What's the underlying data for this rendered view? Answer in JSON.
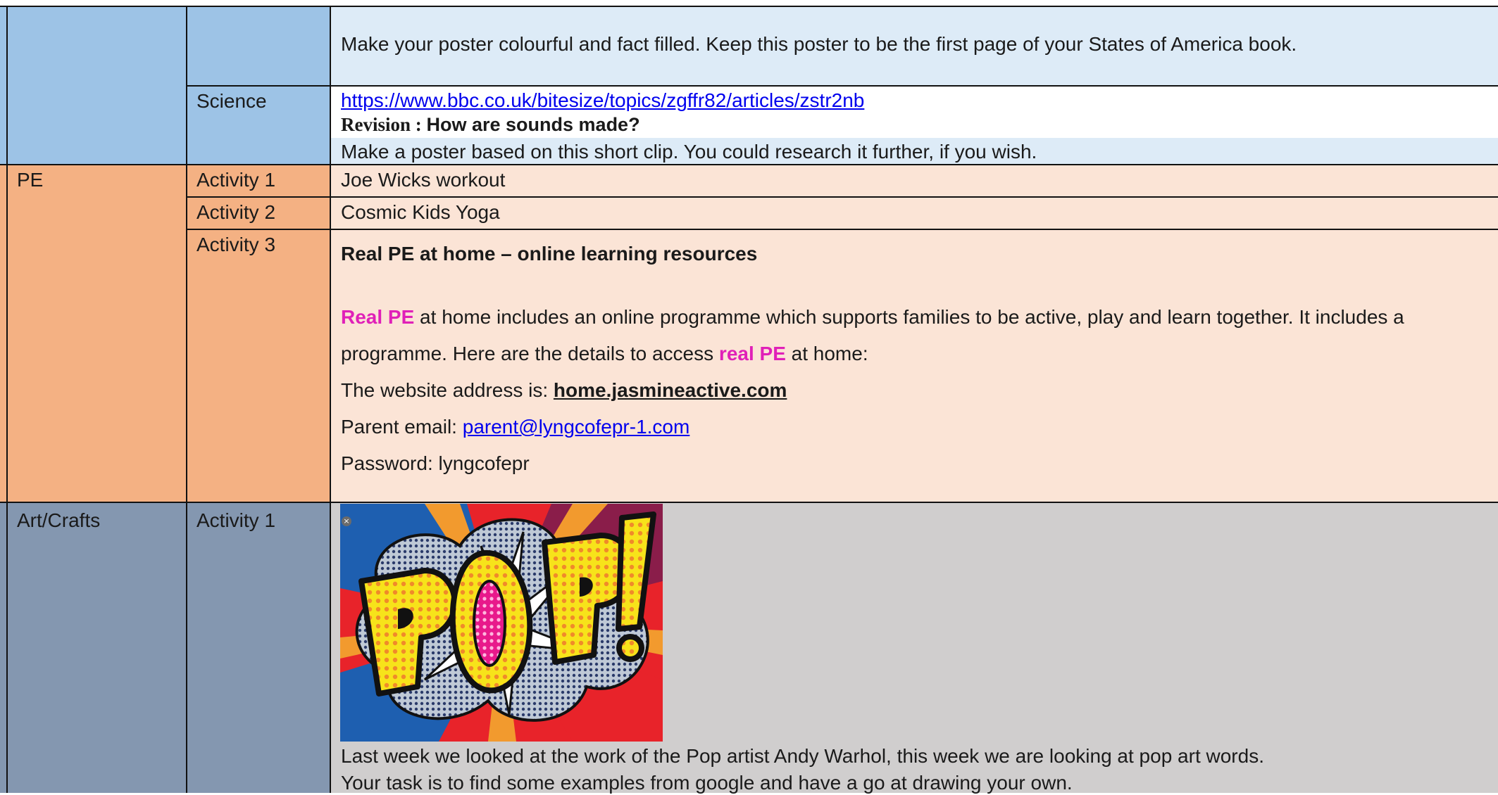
{
  "geography": {
    "task_text": "Make your poster colourful and fact filled. Keep this poster to be the first page of your States of America book."
  },
  "science": {
    "label": "Science",
    "link": "https://www.bbc.co.uk/bitesize/topics/zgffr82/articles/zstr2nb",
    "revision_prefix": "Revision : ",
    "revision_title": "How are sounds made?",
    "task_text": "Make a poster based on this short clip. You could research it further, if you wish."
  },
  "pe": {
    "label": "PE",
    "activity1_label": "Activity 1",
    "activity1_text": "Joe Wicks workout",
    "activity2_label": "Activity 2",
    "activity2_text": "Cosmic Kids Yoga",
    "activity3_label": "Activity 3",
    "activity3_heading": "Real PE at home – online learning resources",
    "para_highlight": "Real PE",
    "para_line1": " at home includes an online programme which supports families to be active, play and learn together. It includes a",
    "para_line2_start": "programme. Here are the details to access ",
    "para_line2_highlight": "real PE",
    "para_line2_end": " at home:",
    "website_label": "The website address is: ",
    "website_value": "home.jasmineactive.com",
    "email_label": "Parent email: ",
    "email_value": "parent@lyngcofepr-1.com",
    "password_label": "Password: ",
    "password_value": "lyngcofepr"
  },
  "art": {
    "label": "Art/Crafts",
    "activity1_label": "Activity 1",
    "image_word": "POP!",
    "line1": "Last week we looked at the work of the Pop artist Andy Warhol, this week we are looking at pop art words.",
    "line2": "Your task is to find some examples from google and have a go at drawing your own."
  },
  "icons": {
    "image_close": "close-icon"
  },
  "colors": {
    "subject_blue": "#9dc3e6",
    "content_light_blue": "#ddebf7",
    "subject_orange": "#f4b183",
    "content_peach": "#fbe4d6",
    "subject_slate": "#8497b0",
    "content_grey": "#d0cece",
    "highlight_pink": "#e020b8",
    "link_blue": "#0000ee"
  }
}
